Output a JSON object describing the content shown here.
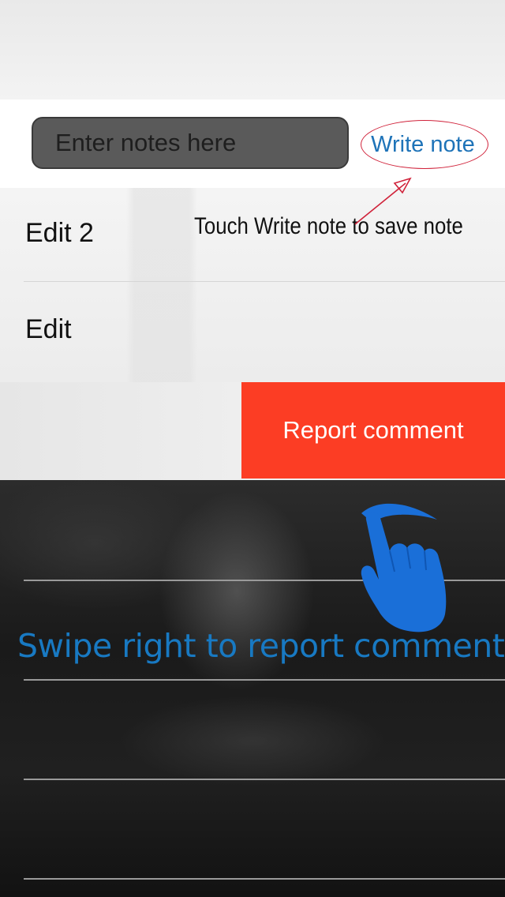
{
  "notes": {
    "placeholder": "Enter notes here",
    "write_note_label": "Write note"
  },
  "list": {
    "items": [
      {
        "label": "Edit 2"
      },
      {
        "label": "Edit"
      }
    ]
  },
  "swipe_action": {
    "report_label": "Report comment"
  },
  "annotations": {
    "touch_hint": "Touch Write note to save note",
    "swipe_hint": "Swipe right to report comment"
  },
  "icons": {
    "hand": "hand-swipe-icon",
    "arrow": "red-arrow-icon"
  },
  "colors": {
    "report_bg": "#fc3d24",
    "link_blue": "#1e73b8",
    "annotation_blue": "#1879c2",
    "hand_blue": "#1a6fd8",
    "annotation_red": "#d0223a"
  }
}
